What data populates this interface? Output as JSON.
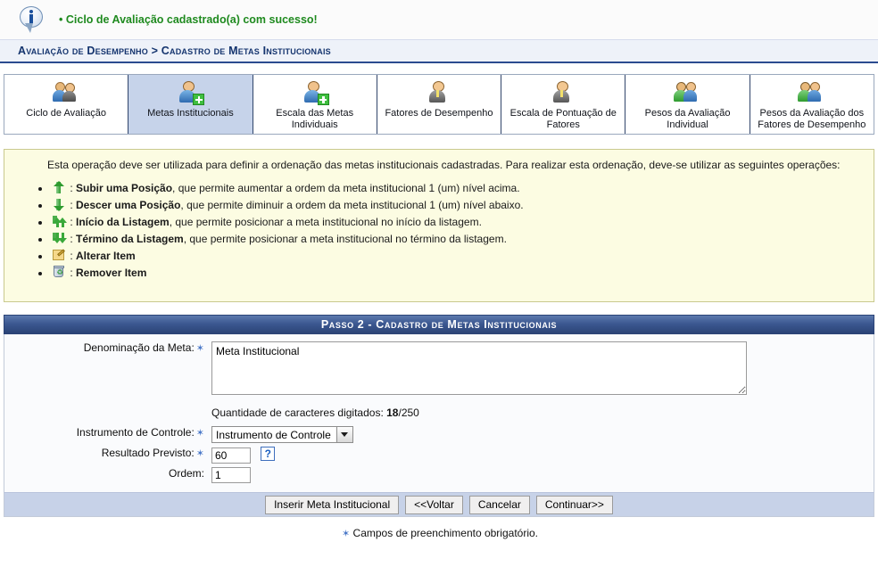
{
  "message": {
    "icon": "info-bubble-icon",
    "bullet": "•",
    "text": "Ciclo de Avaliação cadastrado(a) com sucesso!",
    "color": "#1f8a1f"
  },
  "breadcrumb": {
    "text": "Avaliação de Desempenho > Cadastro de Metas Institucionais"
  },
  "tabs": [
    {
      "label": "Ciclo de Avaliação",
      "icon": "two-people-icon",
      "active": false
    },
    {
      "label": "Metas Institucionais",
      "icon": "person-add-icon",
      "active": true
    },
    {
      "label": "Escala das Metas Individuais",
      "icon": "person-add-icon",
      "active": false
    },
    {
      "label": "Fatores de Desempenho",
      "icon": "person-gray-icon",
      "active": false
    },
    {
      "label": "Escala de Pontuação de Fatores",
      "icon": "person-gray-icon",
      "active": false
    },
    {
      "label": "Pesos da Avaliação Individual",
      "icon": "two-people-green-blue-icon",
      "active": false
    },
    {
      "label": "Pesos da Avaliação dos Fatores de Desempenho",
      "icon": "two-people-green-blue-icon",
      "active": false
    }
  ],
  "help": {
    "intro": "Esta operação deve ser utilizada para definir a ordenação das metas institucionais cadastradas. Para realizar esta ordenação, deve-se utilizar as seguintes operações:",
    "items": [
      {
        "icon": "arrow-up-icon",
        "term": "Subir uma Posição",
        "rest": ", que permite aumentar a ordem da meta institucional 1 (um) nível acima."
      },
      {
        "icon": "arrow-down-icon",
        "term": "Descer uma Posição",
        "rest": ", que permite diminuir a ordem da meta institucional 1 (um) nível abaixo."
      },
      {
        "icon": "double-arrow-up-icon",
        "term": "Início da Listagem",
        "rest": ", que permite posicionar a meta institucional no início da listagem."
      },
      {
        "icon": "double-arrow-down-icon",
        "term": "Término da Listagem",
        "rest": ", que permite posicionar a meta institucional no término da listagem."
      },
      {
        "icon": "edit-pencil-icon",
        "term": "Alterar Item",
        "rest": ""
      },
      {
        "icon": "trash-icon",
        "term": "Remover Item",
        "rest": ""
      }
    ],
    "separator": ": ",
    "background": "#fcfce2",
    "border": "#c9c98e"
  },
  "panel": {
    "title": "Passo 2 - Cadastro de Metas Institucionais",
    "fields": {
      "denominacao": {
        "label": "Denominação da Meta:",
        "value": "Meta Institucional",
        "required": true
      },
      "char_counter": {
        "prefix": "Quantidade de caracteres digitados: ",
        "count": "18",
        "suffix": "/250"
      },
      "instrumento": {
        "label": "Instrumento de Controle:",
        "selected": "Instrumento de Controle",
        "required": true
      },
      "resultado": {
        "label": "Resultado Previsto:",
        "value": "60",
        "required": true,
        "help_glyph": "?"
      },
      "ordem": {
        "label": "Ordem:",
        "value": "1",
        "required": false
      }
    },
    "buttons": [
      {
        "label": "Inserir Meta Institucional",
        "name": "insert-goal-button"
      },
      {
        "label": "<<Voltar",
        "name": "back-button"
      },
      {
        "label": "Cancelar",
        "name": "cancel-button"
      },
      {
        "label": "Continuar>>",
        "name": "continue-button"
      }
    ]
  },
  "footer": {
    "star": "✶",
    "note": "Campos de preenchimento obrigatório."
  },
  "colors": {
    "accent_blue": "#2b4b8f",
    "title_bar": "#3c5891",
    "tab_active": "#c6d3ea",
    "button_bar": "#c7d2e8",
    "success_green": "#1f8a1f",
    "help_yellow": "#fcfce2"
  }
}
